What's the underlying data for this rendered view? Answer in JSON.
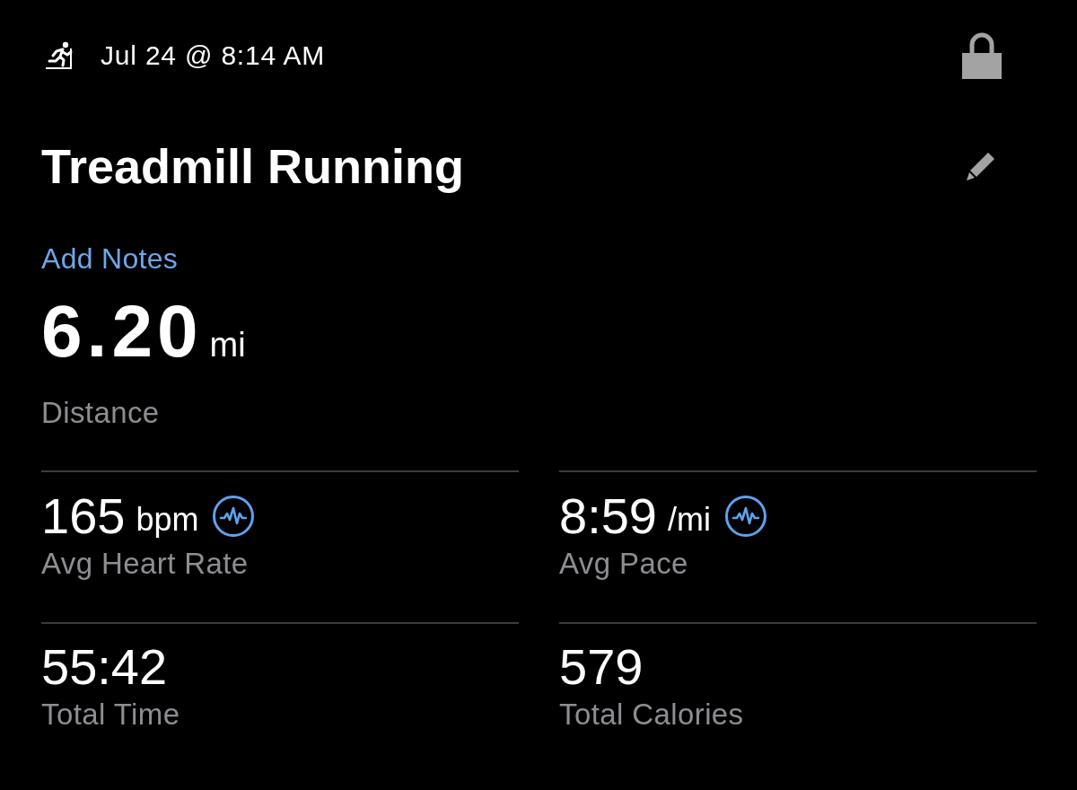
{
  "header": {
    "date": "Jul 24 @ 8:14 AM"
  },
  "title": "Treadmill Running",
  "add_notes": "Add Notes",
  "distance": {
    "value": "6.20",
    "unit": "mi",
    "label": "Distance"
  },
  "stats": [
    {
      "kind": "graph",
      "value": "165",
      "unit": "bpm",
      "label": "Avg Heart Rate"
    },
    {
      "kind": "graph",
      "value": "8:59",
      "unit": "/mi",
      "label": "Avg Pace"
    },
    {
      "kind": "plain",
      "value": "55:42",
      "label": "Total Time"
    },
    {
      "kind": "plain",
      "value": "579",
      "label": "Total Calories"
    }
  ]
}
